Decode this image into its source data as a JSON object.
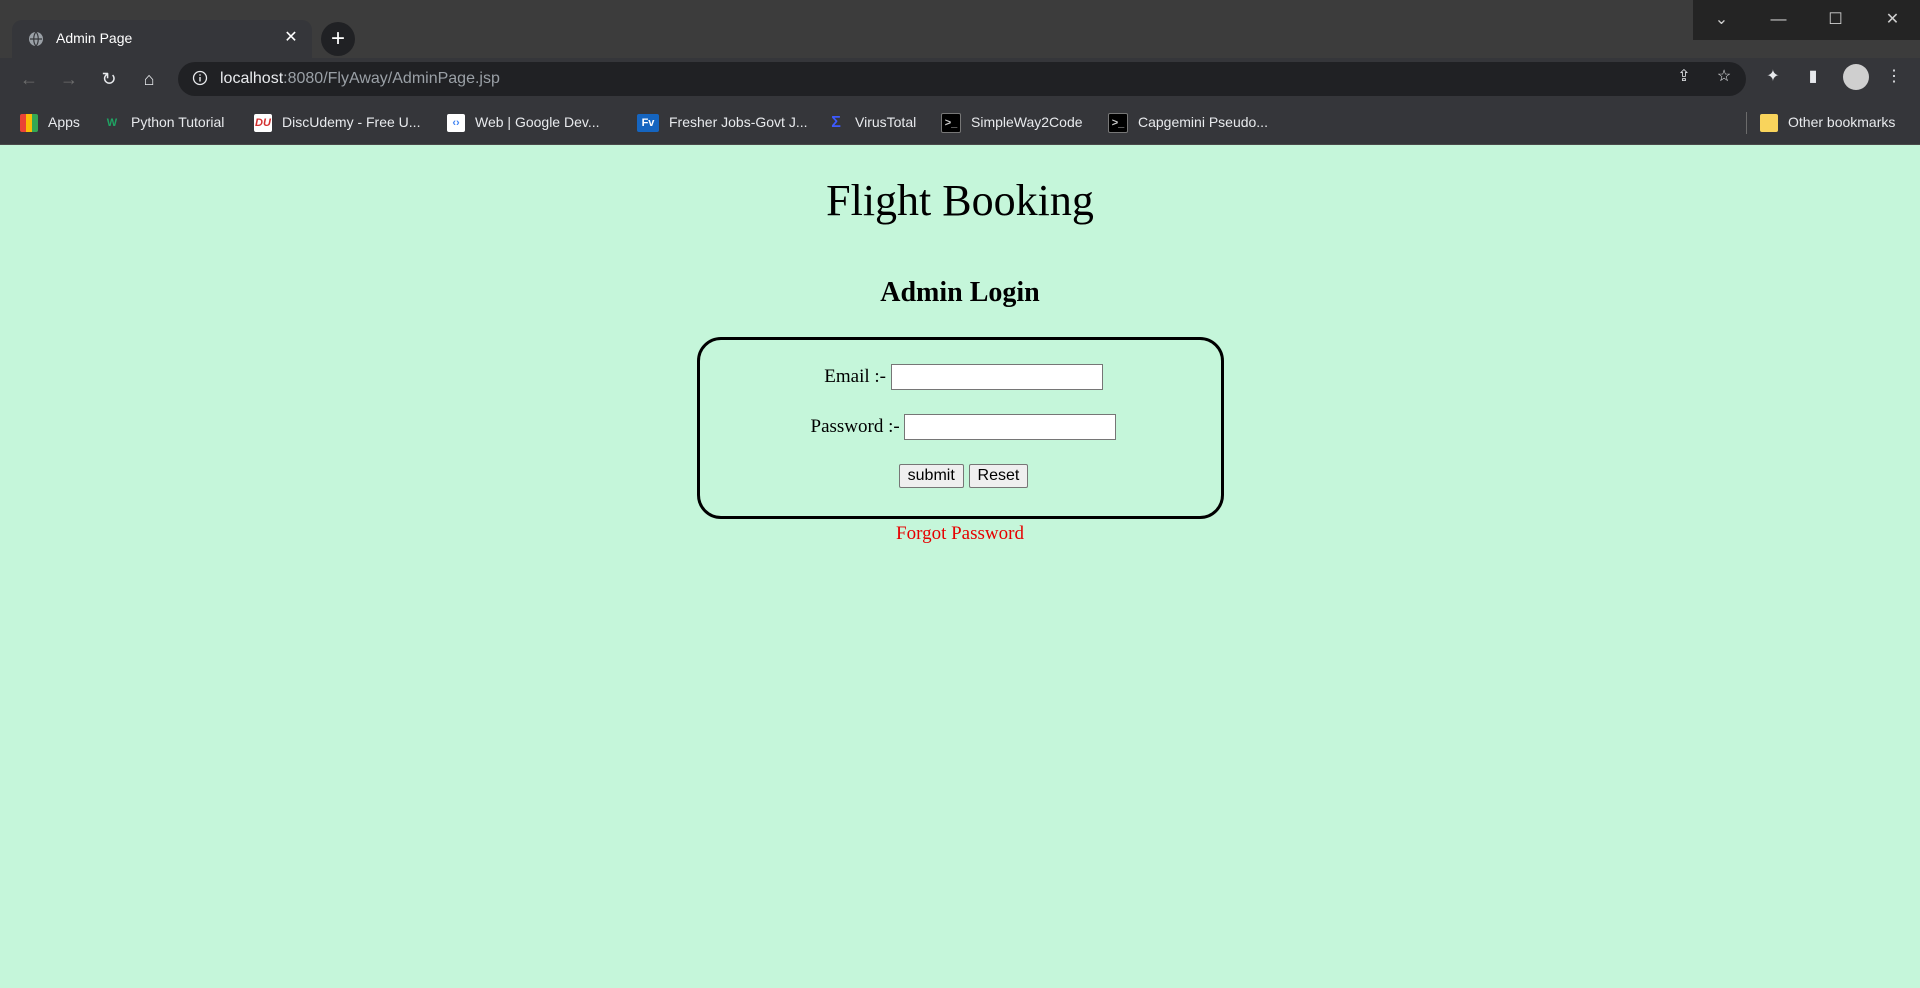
{
  "browser": {
    "tab_title": "Admin Page",
    "url_host": "localhost",
    "url_rest": ":8080/FlyAway/AdminPage.jsp",
    "bookmarks": [
      {
        "label": "Apps",
        "icon": "apps-grid-icon"
      },
      {
        "label": "Python Tutorial",
        "icon": "w-logo-icon"
      },
      {
        "label": "DiscUdemy - Free U...",
        "icon": "discudemy-icon"
      },
      {
        "label": "Web  |  Google Dev...",
        "icon": "google-dev-icon"
      },
      {
        "label": "Fresher Jobs-Govt J...",
        "icon": "fv-icon"
      },
      {
        "label": "VirusTotal",
        "icon": "virustotal-icon"
      },
      {
        "label": "SimpleWay2Code",
        "icon": "terminal-icon"
      },
      {
        "label": "Capgemini Pseudo...",
        "icon": "terminal-icon"
      }
    ],
    "other_bookmarks": "Other bookmarks"
  },
  "page": {
    "title": "Flight Booking",
    "subtitle": "Admin Login",
    "email_label": "Email :-",
    "password_label": "Password :-",
    "email_value": "",
    "password_value": "",
    "submit_label": "submit",
    "reset_label": "Reset",
    "forgot_label": "Forgot Password",
    "background_color": "#c5f6da",
    "link_color": "#e60000"
  }
}
